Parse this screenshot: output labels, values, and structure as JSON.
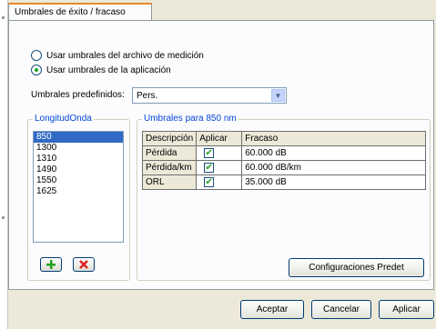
{
  "tab": {
    "label": "Umbrales de éxito / fracaso"
  },
  "options": {
    "from_file": "Usar umbrales del archivo de medición",
    "from_app": "Usar umbrales de la aplicación",
    "selected": "from_app"
  },
  "preset": {
    "label": "Umbrales predefinidos:",
    "value": "Pers."
  },
  "wavelength": {
    "legend": "LongitudOnda",
    "items": [
      "850",
      "1300",
      "1310",
      "1490",
      "1550",
      "1625"
    ],
    "selected": "850"
  },
  "thresholds": {
    "legend": "Umbrales para 850 nm",
    "columns": [
      "Descripción",
      "Aplicar",
      "Fracaso"
    ],
    "rows": [
      {
        "desc": "Pérdida",
        "apply": true,
        "fail": "60.000 dB"
      },
      {
        "desc": "Pérdida/km",
        "apply": true,
        "fail": "60.000 dB/km"
      },
      {
        "desc": "ORL",
        "apply": true,
        "fail": "35.000 dB"
      }
    ]
  },
  "buttons": {
    "config": "Configuraciones Predet",
    "ok": "Aceptar",
    "cancel": "Cancelar",
    "apply": "Aplicar"
  },
  "colors": {
    "add_icon": "#21a121",
    "remove_icon": "#e02020",
    "legend_text": "#0046d5",
    "selection": "#316ac5"
  }
}
